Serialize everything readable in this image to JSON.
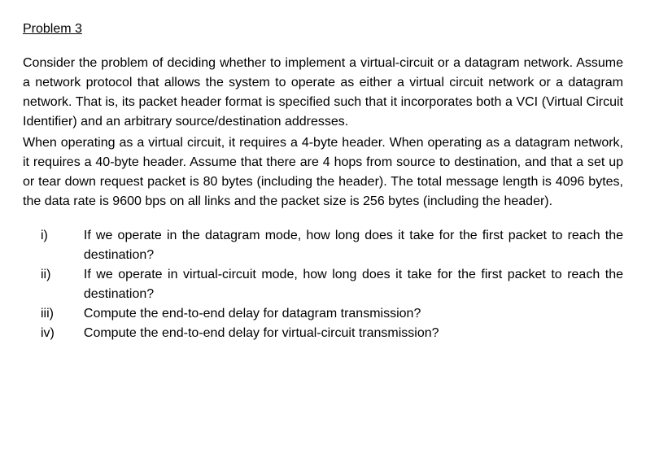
{
  "title": "Problem 3",
  "paragraph1": "Consider the problem of deciding whether to implement a virtual-circuit or a datagram network. Assume a network protocol that allows the system to operate as either a virtual circuit network or a datagram network. That is, its packet header format is specified such that it incorporates both a VCI (Virtual Circuit Identifier) and an arbitrary source/destination addresses.",
  "paragraph2": "When operating as a virtual circuit, it requires a 4-byte header. When operating as a datagram network, it requires a 40-byte header. Assume that there are 4 hops from source to destination, and that a set up or tear down request packet is 80 bytes (including the header). The total message length is 4096 bytes, the data rate is 9600 bps on all links and the packet size is 256 bytes (including the header).",
  "items": {
    "0": {
      "marker": "i)",
      "text": "If we operate in the datagram mode, how long does it take for the first packet to reach the destination?"
    },
    "1": {
      "marker": "ii)",
      "text": "If we operate in virtual-circuit mode, how long does it take for the first packet to reach the destination?"
    },
    "2": {
      "marker": "iii)",
      "text": "Compute the end-to-end delay for datagram transmission?"
    },
    "3": {
      "marker": "iv)",
      "text": "Compute the end-to-end delay for virtual-circuit transmission?"
    }
  }
}
